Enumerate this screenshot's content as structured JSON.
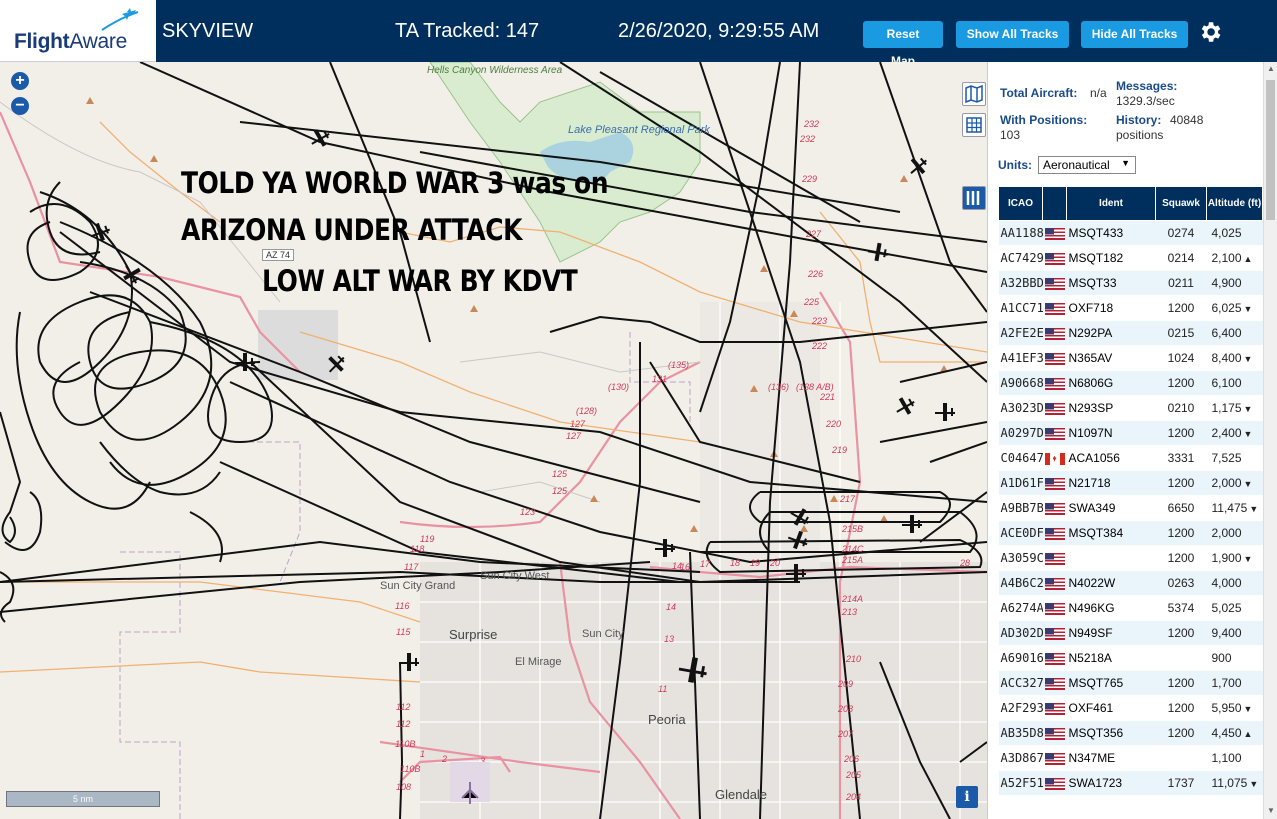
{
  "header": {
    "logo_text_flight": "Flight",
    "logo_text_aware": "Aware",
    "app_name": "SKYVIEW",
    "ta_tracked": "TA Tracked: 147",
    "datetime": "2/26/2020, 9:29:55 AM",
    "buttons": {
      "reset_map": "Reset Map",
      "show_all_tracks": "Show All Tracks",
      "hide_all_tracks": "Hide All Tracks"
    }
  },
  "map": {
    "overlay_lines": [
      "TOLD YA WORLD WAR 3 was on",
      "ARIZONA UNDER ATTACK",
      "LOW ALT WAR BY KDVT"
    ],
    "places": {
      "hells_canyon": "Hells Canyon Wilderness Area",
      "lake_pleasant": "Lake Pleasant Regional Park",
      "sun_city_grand": "Sun City Grand",
      "sun_city_west": "Sun City West",
      "surprise": "Surprise",
      "sun_city": "Sun City",
      "el_mirage": "El Mirage",
      "peoria": "Peoria",
      "glendale": "Glendale",
      "az74": "AZ 74"
    },
    "scale_label": "5 nm",
    "info_label": "i"
  },
  "panel": {
    "total_aircraft_label": "Total Aircraft:",
    "total_aircraft_value": "n/a",
    "messages_label": "Messages:",
    "messages_value": "1329.3/sec",
    "with_positions_label": "With Positions:",
    "with_positions_value": "103",
    "history_label": "History:",
    "history_value_a": "40848",
    "history_value_b": "positions",
    "units_label": "Units:",
    "units_selected": "Aeronautical",
    "columns": {
      "icao": "ICAO",
      "ident": "Ident",
      "squawk": "Squawk",
      "altitude": "Altitude (ft)"
    },
    "rows": [
      {
        "icao": "AA1188",
        "flag": "us",
        "ident": "MSQT433",
        "squawk": "0274",
        "alt": "4,025",
        "trend": ""
      },
      {
        "icao": "AC7429",
        "flag": "us",
        "ident": "MSQT182",
        "squawk": "0214",
        "alt": "2,100",
        "trend": "▲"
      },
      {
        "icao": "A32BBD",
        "flag": "us",
        "ident": "MSQT33",
        "squawk": "0211",
        "alt": "4,900",
        "trend": ""
      },
      {
        "icao": "A1CC71",
        "flag": "us",
        "ident": "OXF718",
        "squawk": "1200",
        "alt": "6,025",
        "trend": "▼"
      },
      {
        "icao": "A2FE2E",
        "flag": "us",
        "ident": "N292PA",
        "squawk": "0215",
        "alt": "6,400",
        "trend": ""
      },
      {
        "icao": "A41EF3",
        "flag": "us",
        "ident": "N365AV",
        "squawk": "1024",
        "alt": "8,400",
        "trend": "▼"
      },
      {
        "icao": "A90668",
        "flag": "us",
        "ident": "N6806G",
        "squawk": "1200",
        "alt": "6,100",
        "trend": ""
      },
      {
        "icao": "A3023D",
        "flag": "us",
        "ident": "N293SP",
        "squawk": "0210",
        "alt": "1,175",
        "trend": "▼"
      },
      {
        "icao": "A0297D",
        "flag": "us",
        "ident": "N1097N",
        "squawk": "1200",
        "alt": "2,400",
        "trend": "▼"
      },
      {
        "icao": "C04647",
        "flag": "ca",
        "ident": "ACA1056",
        "squawk": "3331",
        "alt": "7,525",
        "trend": ""
      },
      {
        "icao": "A1D61F",
        "flag": "us",
        "ident": "N21718",
        "squawk": "1200",
        "alt": "2,000",
        "trend": "▼"
      },
      {
        "icao": "A9BB7B",
        "flag": "us",
        "ident": "SWA349",
        "squawk": "6650",
        "alt": "11,475",
        "trend": "▼"
      },
      {
        "icao": "ACE0DF",
        "flag": "us",
        "ident": "MSQT384",
        "squawk": "1200",
        "alt": "2,000",
        "trend": ""
      },
      {
        "icao": "A3059C",
        "flag": "us",
        "ident": "",
        "squawk": "1200",
        "alt": "1,900",
        "trend": "▼"
      },
      {
        "icao": "A4B6C2",
        "flag": "us",
        "ident": "N4022W",
        "squawk": "0263",
        "alt": "4,000",
        "trend": ""
      },
      {
        "icao": "A6274A",
        "flag": "us",
        "ident": "N496KG",
        "squawk": "5374",
        "alt": "5,025",
        "trend": ""
      },
      {
        "icao": "AD302D",
        "flag": "us",
        "ident": "N949SF",
        "squawk": "1200",
        "alt": "9,400",
        "trend": ""
      },
      {
        "icao": "A69016",
        "flag": "us",
        "ident": "N5218A",
        "squawk": "",
        "alt": "900",
        "trend": ""
      },
      {
        "icao": "ACC327",
        "flag": "us",
        "ident": "MSQT765",
        "squawk": "1200",
        "alt": "1,700",
        "trend": ""
      },
      {
        "icao": "A2F293",
        "flag": "us",
        "ident": "OXF461",
        "squawk": "1200",
        "alt": "5,950",
        "trend": "▼"
      },
      {
        "icao": "AB35D8",
        "flag": "us",
        "ident": "MSQT356",
        "squawk": "1200",
        "alt": "4,450",
        "trend": "▲"
      },
      {
        "icao": "A3D867",
        "flag": "us",
        "ident": "N347ME",
        "squawk": "",
        "alt": "1,100",
        "trend": ""
      },
      {
        "icao": "A52F51",
        "flag": "us",
        "ident": "SWA1723",
        "squawk": "1737",
        "alt": "11,075",
        "trend": "▼"
      }
    ]
  },
  "icons": [
    "flightaware-logo-plane-icon",
    "gear-icon",
    "zoom-in-icon",
    "zoom-out-icon",
    "map-layers-icon",
    "grid-icon",
    "columns-icon",
    "info-icon",
    "aircraft-icon"
  ]
}
